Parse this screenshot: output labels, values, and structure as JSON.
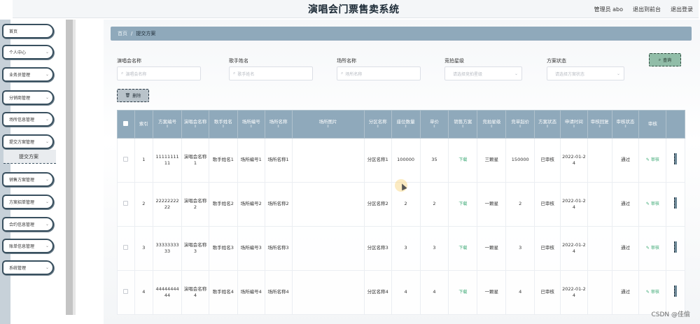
{
  "header": {
    "title": "演唱会门票售卖系统",
    "admin_label": "管理员 abo",
    "exit_frontend": "退出到前台",
    "logout": "退出登录"
  },
  "sidebar": {
    "items": [
      {
        "label": "首页",
        "has_chevron": false
      },
      {
        "label": "个人中心",
        "has_chevron": true
      },
      {
        "label": "业务员管理",
        "has_chevron": true
      },
      {
        "label": "分销商管理",
        "has_chevron": true
      },
      {
        "label": "场所信息管理",
        "has_chevron": true
      },
      {
        "label": "提交方案管理",
        "has_chevron": true
      },
      {
        "label": "销售方案管理",
        "has_chevron": true
      },
      {
        "label": "方案招单管理",
        "has_chevron": true
      },
      {
        "label": "合约信息管理",
        "has_chevron": true
      },
      {
        "label": "账单信息管理",
        "has_chevron": true
      },
      {
        "label": "系统管理",
        "has_chevron": true
      }
    ],
    "active_sub": "提交方案"
  },
  "breadcrumb": {
    "home": "首页",
    "separator": "/",
    "current": "提交方案"
  },
  "filters": {
    "concert_name": {
      "label": "演唱会名称",
      "placeholder": "演唱会名称"
    },
    "singer_name": {
      "label": "歌手姓名",
      "placeholder": "歌手姓名"
    },
    "venue_name": {
      "label": "场所名称",
      "placeholder": "场所名称"
    },
    "star_level": {
      "label": "竞拍星级",
      "placeholder": "请选择竞拍星级"
    },
    "plan_status": {
      "label": "方案状态",
      "placeholder": "请选择方案状态"
    },
    "query_button": "查询",
    "delete_button": "删除"
  },
  "table": {
    "columns": [
      "索引",
      "方案编号",
      "演唱会名称",
      "歌手姓名",
      "场所编号",
      "场所名称",
      "场所图片",
      "分区名称",
      "座位数量",
      "单价",
      "销售方案",
      "竞拍星级",
      "竞单起价",
      "方案状态",
      "申请时间",
      "审核回复",
      "审核状态",
      "审核"
    ],
    "rows": [
      {
        "index": "1",
        "plan_no": "1111111111",
        "concert": "演唱会名称1",
        "singer": "歌手姓名1",
        "venue_no": "场所编号1",
        "venue_name": "场所名称1",
        "venue_img": "",
        "zone": "分区名称1",
        "seats": "100000",
        "price": "35",
        "sales_plan": "下载",
        "star": "三颗星",
        "start_price": "150000",
        "plan_status": "已审核",
        "apply_time": "2022-01-24",
        "reply": "",
        "audit_status": "通过",
        "audit": "审核"
      },
      {
        "index": "2",
        "plan_no": "2222222222",
        "concert": "演唱会名称2",
        "singer": "歌手姓名2",
        "venue_no": "场所编号2",
        "venue_name": "场所名称2",
        "venue_img": "",
        "zone": "分区名称2",
        "seats": "2",
        "price": "2",
        "sales_plan": "下载",
        "star": "一颗星",
        "start_price": "2",
        "plan_status": "已审核",
        "apply_time": "2022-01-24",
        "reply": "",
        "audit_status": "通过",
        "audit": "审核"
      },
      {
        "index": "3",
        "plan_no": "3333333333",
        "concert": "演唱会名称3",
        "singer": "歌手姓名3",
        "venue_no": "场所编号3",
        "venue_name": "场所名称3",
        "venue_img": "",
        "zone": "分区名称3",
        "seats": "3",
        "price": "3",
        "sales_plan": "下载",
        "star": "一颗星",
        "start_price": "3",
        "plan_status": "已审核",
        "apply_time": "2022-01-24",
        "reply": "",
        "audit_status": "通过",
        "audit": "审核"
      },
      {
        "index": "4",
        "plan_no": "4444444444",
        "concert": "演唱会名称4",
        "singer": "歌手姓名4",
        "venue_no": "场所编号4",
        "venue_name": "场所名称4",
        "venue_img": "",
        "zone": "分区名称4",
        "seats": "4",
        "price": "4",
        "sales_plan": "下载",
        "star": "一颗星",
        "start_price": "4",
        "plan_status": "已审核",
        "apply_time": "2022-01-24",
        "reply": "",
        "audit_status": "通过",
        "audit": "审核"
      }
    ]
  },
  "watermark": "CSDN @佳偷",
  "icons": {
    "search": "search-icon",
    "delete": "trash-icon",
    "chevron": "chevron-down-icon",
    "audit": "edit-icon"
  },
  "colors": {
    "accent": "#8fa9bb",
    "query_button": "#91bda8",
    "link_green": "#3aa873",
    "menu_border": "#39505f"
  }
}
